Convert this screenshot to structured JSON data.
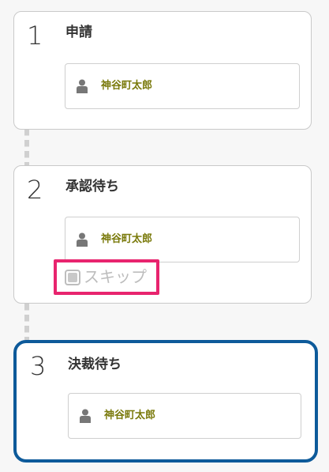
{
  "workflow": {
    "steps": [
      {
        "number": "1",
        "title": "申請",
        "assignee": "神谷町太郎",
        "assignee_icon": "person-icon"
      },
      {
        "number": "2",
        "title": "承認待ち",
        "assignee": "神谷町太郎",
        "assignee_icon": "person-icon",
        "skip_label": "スキップ",
        "skip_checked": false
      },
      {
        "number": "3",
        "title": "決裁待ち",
        "assignee": "神谷町太郎",
        "assignee_icon": "person-icon",
        "is_current": true
      }
    ]
  },
  "colors": {
    "current_step_border": "#0d5a9a",
    "skip_highlight": "#e8246e",
    "assignee_name": "#7a7a0c"
  }
}
